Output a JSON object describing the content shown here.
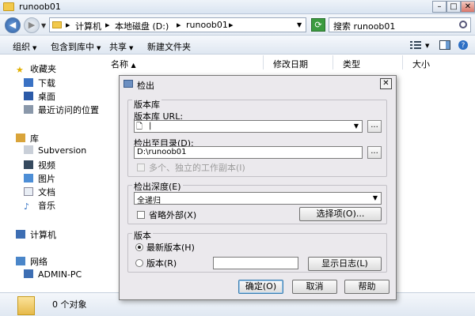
{
  "window": {
    "title": "runoob01"
  },
  "address": {
    "crumbs": [
      "▸",
      "计算机",
      "▸",
      "本地磁盘 (D:)",
      "▸",
      "runoob01",
      "▸"
    ],
    "search_placeholder": "搜索 runoob01"
  },
  "toolbar": {
    "organize": "组织",
    "include_in_library": "包含到库中",
    "share": "共享",
    "new_folder": "新建文件夹"
  },
  "columns": {
    "name": "名称",
    "modified": "修改日期",
    "type": "类型",
    "size": "大小"
  },
  "sidebar": {
    "favorites": "收藏夹",
    "downloads": "下载",
    "desktop": "桌面",
    "recent": "最近访问的位置",
    "libraries": "库",
    "subversion": "Subversion",
    "videos": "视频",
    "pictures": "图片",
    "documents": "文档",
    "music": "音乐",
    "computer": "计算机",
    "network": "网络",
    "admin_pc": "ADMIN-PC"
  },
  "status": {
    "text": "0 个对象"
  },
  "dialog": {
    "title": "检出",
    "repo_group": "版本库",
    "repo_url_label": "版本库 URL:",
    "repo_url_value": "|",
    "checkout_dir_label": "检出至目录(D):",
    "checkout_dir_value": "D:\\runoob01",
    "multi_checkout": "多个、独立的工作副本(I)",
    "depth_group": "检出深度(E)",
    "depth_value": "全递归",
    "omit_externals": "省略外部(X)",
    "options_button": "选择项(O)...",
    "revision_group": "版本",
    "head_revision": "最新版本(H)",
    "revision": "版本(R)",
    "show_log_button": "显示日志(L)",
    "ok_button": "确定(O)",
    "cancel_button": "取消",
    "help_button": "帮助"
  }
}
